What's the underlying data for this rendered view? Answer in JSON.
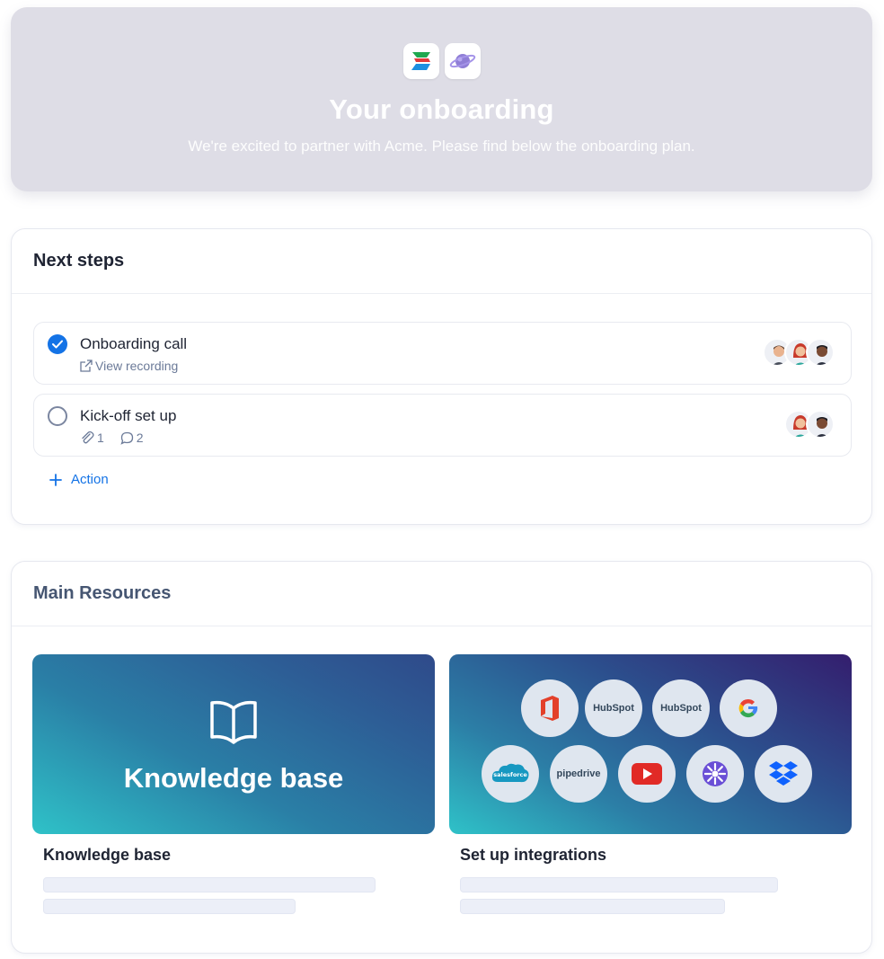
{
  "hero": {
    "title": "Your onboarding",
    "subtitle": "We're excited to partner with Acme. Please find below the onboarding plan.",
    "logos": [
      "s-brand-logo",
      "planet-logo"
    ]
  },
  "next_steps": {
    "heading": "Next steps",
    "items": [
      {
        "title": "Onboarding call",
        "status": "done",
        "meta_link": "View recording"
      },
      {
        "title": "Kick-off set up",
        "status": "open",
        "attachments": "1",
        "comments": "2"
      }
    ],
    "add_action_label": "Action"
  },
  "resources": {
    "heading": "Main Resources",
    "cards": [
      {
        "tile_title": "Knowledge base",
        "label": "Knowledge base"
      },
      {
        "label": "Set up integrations"
      }
    ],
    "integrations": [
      {
        "name": "office-icon"
      },
      {
        "name": "hubspot-icon",
        "text": "HubSpot"
      },
      {
        "name": "hubspot-icon",
        "text": "HubSpot"
      },
      {
        "name": "google-icon"
      },
      {
        "name": "salesforce-icon",
        "text": "salesforce"
      },
      {
        "name": "pipedrive-icon",
        "text": "pipedrive"
      },
      {
        "name": "youtube-icon"
      },
      {
        "name": "sunburst-icon"
      },
      {
        "name": "dropbox-icon"
      }
    ]
  },
  "colors": {
    "accent": "#1473e6",
    "hero_bg": "#dedde6"
  }
}
